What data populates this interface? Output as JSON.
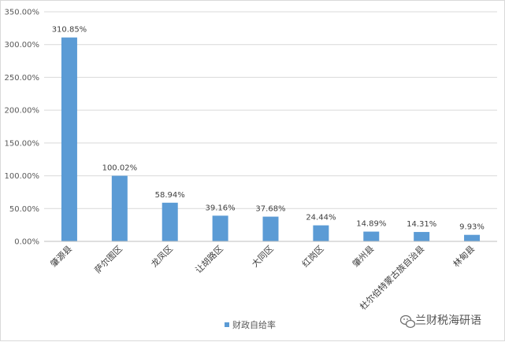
{
  "chart_data": {
    "type": "bar",
    "categories": [
      "肇源县",
      "萨尔图区",
      "龙凤区",
      "让胡路区",
      "大同区",
      "红岗区",
      "肇州县",
      "杜尔伯特蒙古族自治县",
      "林甸县"
    ],
    "series": [
      {
        "name": "财政自给率",
        "values": [
          310.85,
          100.02,
          58.94,
          39.16,
          37.68,
          24.44,
          14.89,
          14.31,
          9.93
        ],
        "labels": [
          "310.85%",
          "100.02%",
          "58.94%",
          "39.16%",
          "37.68%",
          "24.44%",
          "14.89%",
          "14.31%",
          "9.93%"
        ],
        "color": "#5b9bd5"
      }
    ],
    "yticks": [
      "0.00%",
      "50.00%",
      "100.00%",
      "150.00%",
      "200.00%",
      "250.00%",
      "300.00%",
      "350.00%"
    ],
    "ylim": [
      0,
      350
    ],
    "grid": true,
    "legend_position": "bottom"
  },
  "watermark": {
    "text": "兰财税海研语"
  },
  "colors": {
    "grid": "#d9d9d9",
    "axis": "#bfbfbf"
  }
}
